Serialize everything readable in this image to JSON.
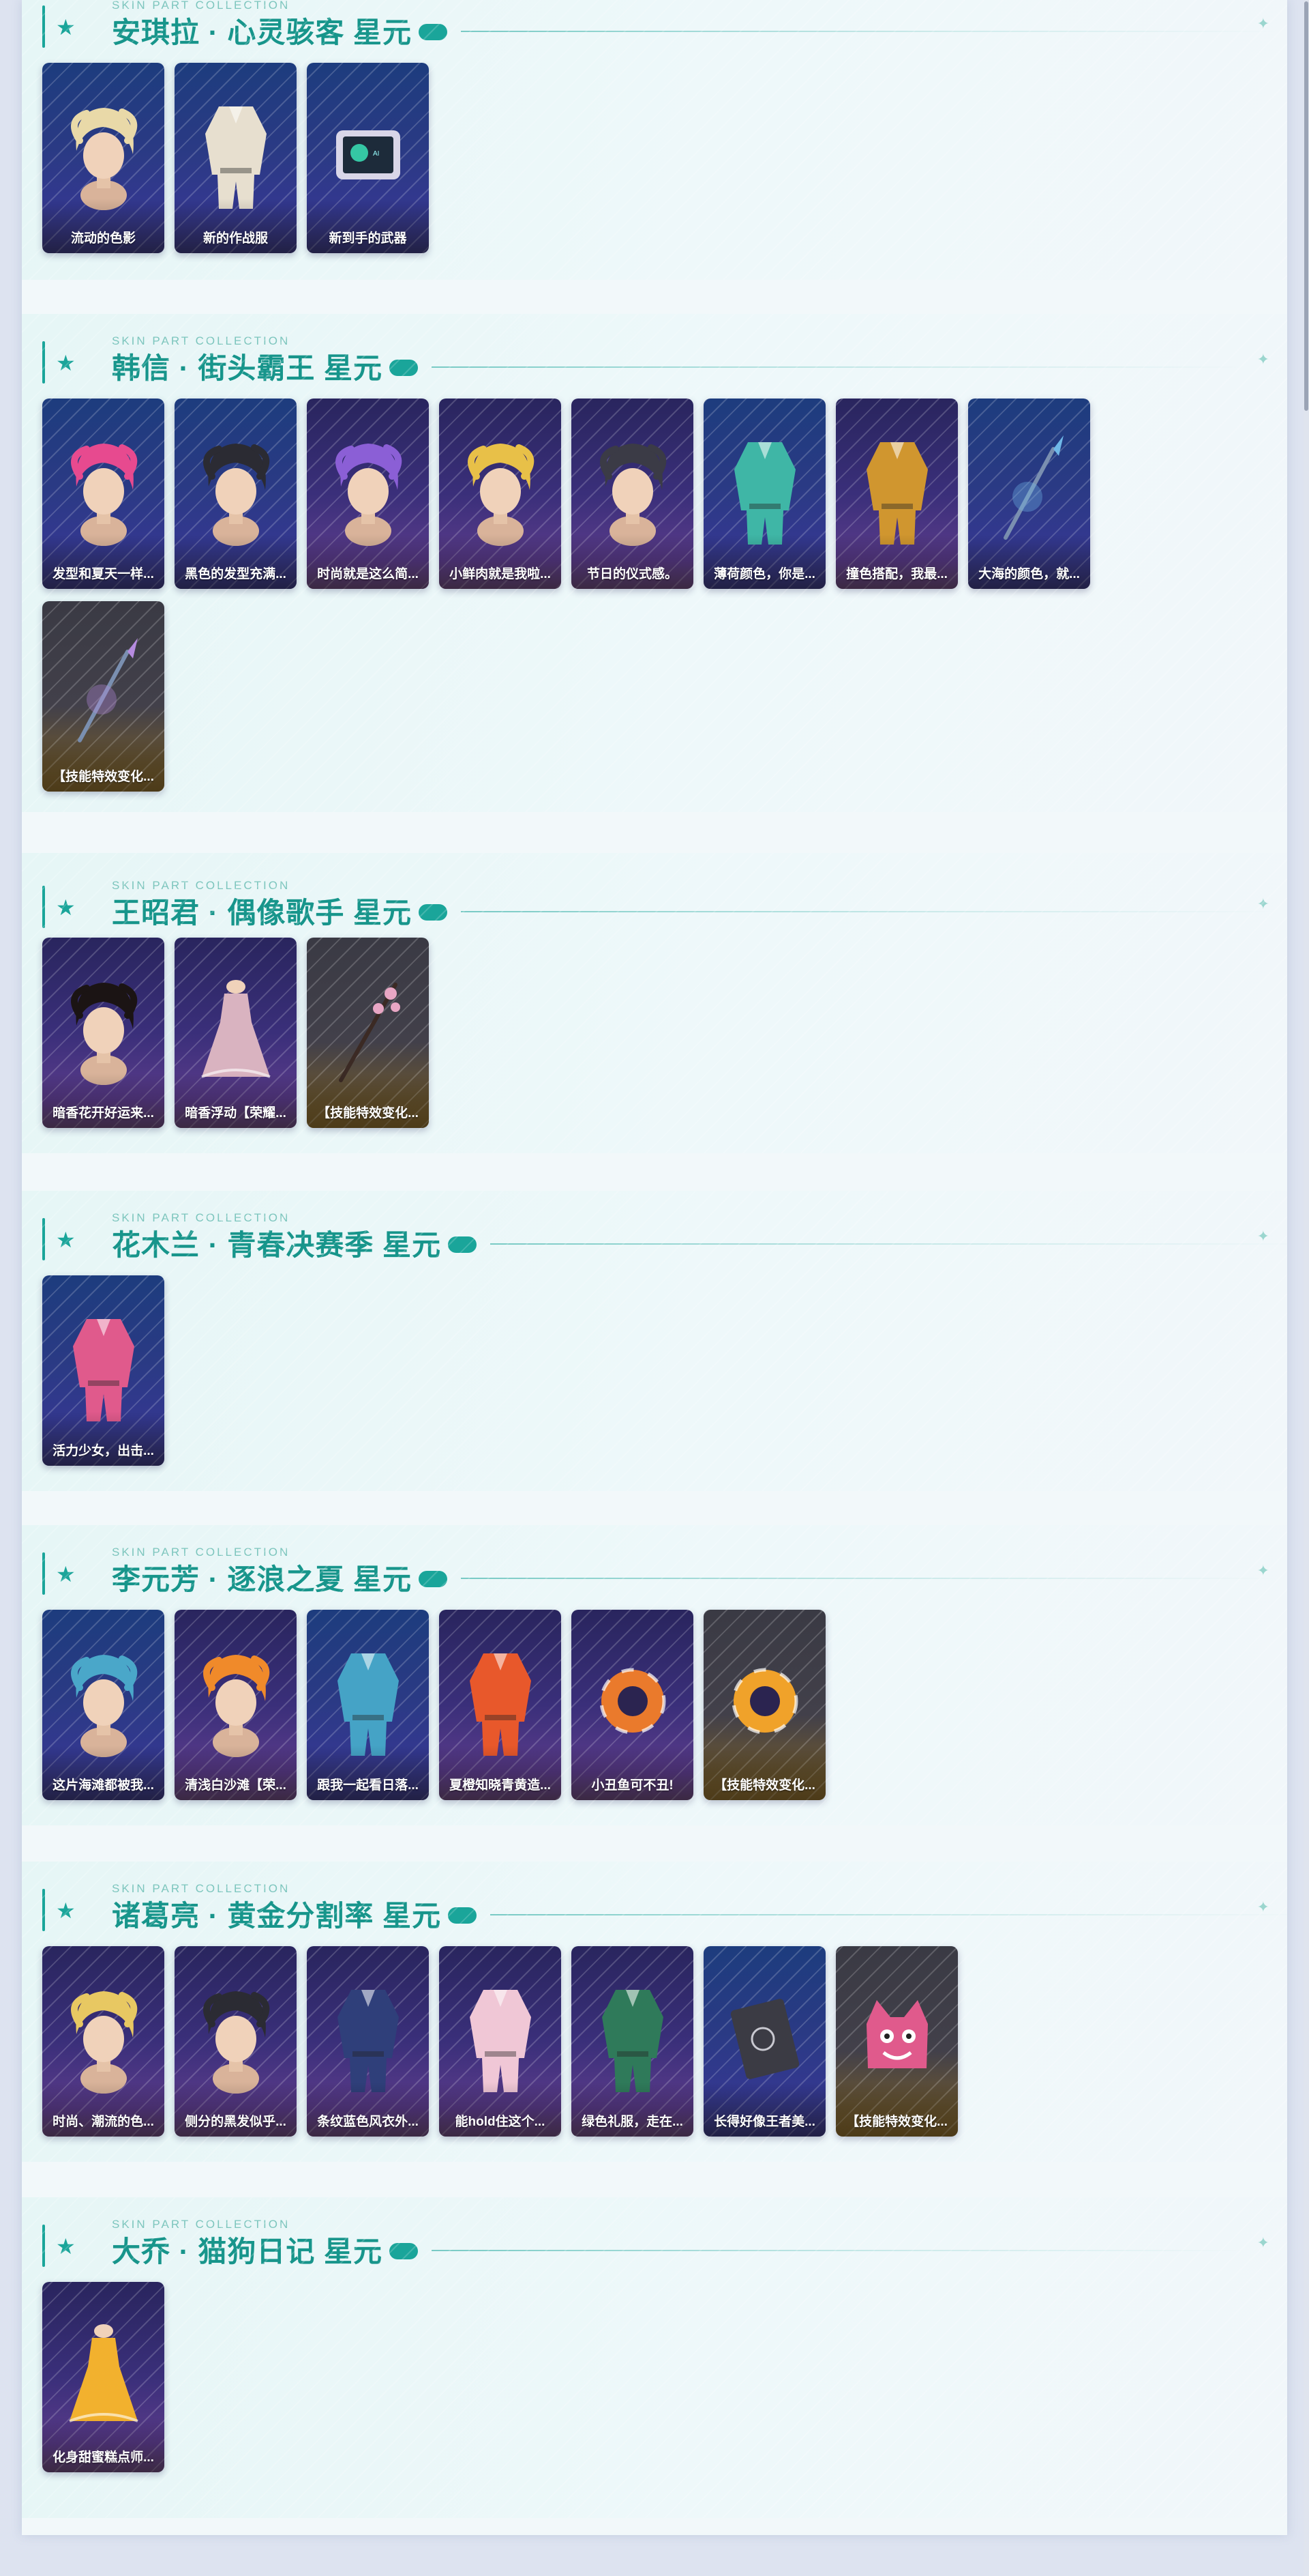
{
  "subtitle": "SKIN PART COLLECTION",
  "colors": {
    "accent": "#1aa59a",
    "title": "#17958b",
    "page": "#f2f8fa"
  },
  "sections": [
    {
      "title": "安琪拉 · 心灵骇客 星元",
      "items": [
        {
          "label": "流动的色影",
          "icon": "hair-icon",
          "tone": "blue",
          "color": "#e9d9a8"
        },
        {
          "label": "新的作战服",
          "icon": "outfit-icon",
          "tone": "blue",
          "color": "#e7dfcf"
        },
        {
          "label": "新到手的武器",
          "icon": "device-icon",
          "tone": "blue",
          "color": "#d9d6e8"
        }
      ]
    },
    {
      "title": "韩信 · 街头霸王 星元",
      "items": [
        {
          "label": "发型和夏天一样...",
          "icon": "hair-icon",
          "tone": "blue",
          "color": "#e74a8f"
        },
        {
          "label": "黑色的发型充满...",
          "icon": "hair-icon",
          "tone": "blue",
          "color": "#2b2b33"
        },
        {
          "label": "时尚就是这么简...",
          "icon": "hair-icon",
          "tone": "purple",
          "color": "#8b5fd6"
        },
        {
          "label": "小鲜肉就是我啦...",
          "icon": "hair-icon",
          "tone": "purple",
          "color": "#e8c048"
        },
        {
          "label": "节日的仪式感。",
          "icon": "hair-icon",
          "tone": "purple",
          "color": "#3b3b46"
        },
        {
          "label": "薄荷颜色，你是...",
          "icon": "outfit-icon",
          "tone": "blue",
          "color": "#3fb6a6"
        },
        {
          "label": "撞色搭配，我最...",
          "icon": "outfit-icon",
          "tone": "purple",
          "color": "#d0962f"
        },
        {
          "label": "大海的颜色，就...",
          "icon": "spear-icon",
          "tone": "blue",
          "color": "#6fb8e8"
        },
        {
          "label": "【技能特效变化...",
          "icon": "spear-icon",
          "tone": "gold",
          "color": "#b68be0"
        }
      ]
    },
    {
      "title": "王昭君 · 偶像歌手 星元",
      "items": [
        {
          "label": "暗香花开好运来...",
          "icon": "hair-icon",
          "tone": "purple",
          "color": "#1b1414"
        },
        {
          "label": "暗香浮动【荣耀...",
          "icon": "dress-icon",
          "tone": "purple",
          "color": "#d9b3c0"
        },
        {
          "label": "【技能特效变化...",
          "icon": "staff-icon",
          "tone": "gold",
          "color": "#e8a6c4"
        }
      ]
    },
    {
      "title": "花木兰 · 青春决赛季 星元",
      "items": [
        {
          "label": "活力少女，出击...",
          "icon": "outfit-icon",
          "tone": "blue",
          "color": "#e05a8c"
        }
      ]
    },
    {
      "title": "李元芳 · 逐浪之夏 星元",
      "items": [
        {
          "label": "这片海滩都被我...",
          "icon": "hair-icon",
          "tone": "blue",
          "color": "#4aa7c9"
        },
        {
          "label": "清浅白沙滩【荣...",
          "icon": "hair-icon",
          "tone": "purple",
          "color": "#f08a2a"
        },
        {
          "label": "跟我一起看日落...",
          "icon": "outfit-icon",
          "tone": "blue",
          "color": "#45a3c6"
        },
        {
          "label": "夏橙知晓青黄造...",
          "icon": "outfit-icon",
          "tone": "purple",
          "color": "#e8582b"
        },
        {
          "label": "小丑鱼可不丑!",
          "icon": "ring-icon",
          "tone": "purple",
          "color": "#ea7a2c"
        },
        {
          "label": "【技能特效变化...",
          "icon": "ring-icon",
          "tone": "gold",
          "color": "#f0a22a"
        }
      ]
    },
    {
      "title": "诸葛亮 · 黄金分割率 星元",
      "items": [
        {
          "label": "时尚、潮流的色...",
          "icon": "hair-icon",
          "tone": "purple",
          "color": "#e8c862"
        },
        {
          "label": "侧分的黑发似乎...",
          "icon": "hair-icon",
          "tone": "purple",
          "color": "#2b2b33"
        },
        {
          "label": "条纹蓝色风衣外...",
          "icon": "outfit-icon",
          "tone": "purple",
          "color": "#2f3f7a"
        },
        {
          "label": "能hold住这个...",
          "icon": "outfit-icon",
          "tone": "purple",
          "color": "#f0c7d6"
        },
        {
          "label": "绿色礼服，走在...",
          "icon": "outfit-icon",
          "tone": "purple",
          "color": "#2f7a5a"
        },
        {
          "label": "长得好像王者美...",
          "icon": "book-icon",
          "tone": "blue",
          "color": "#3b3b44"
        },
        {
          "label": "【技能特效变化...",
          "icon": "creature-icon",
          "tone": "gold",
          "color": "#e05a8c"
        }
      ]
    },
    {
      "title": "大乔 · 猫狗日记 星元",
      "items": [
        {
          "label": "化身甜蜜糕点师...",
          "icon": "dress-icon",
          "tone": "purple",
          "color": "#f2b12e"
        }
      ]
    }
  ]
}
